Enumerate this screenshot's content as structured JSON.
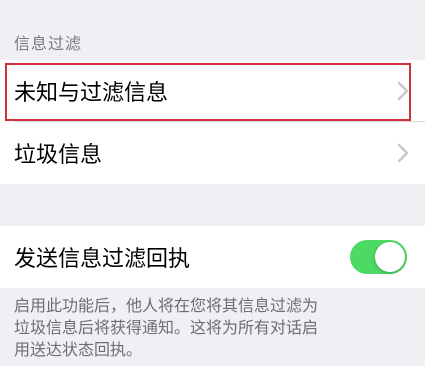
{
  "filter_section": {
    "header": "信息过滤",
    "items": [
      {
        "label": "未知与过滤信息",
        "icon": "chevron-right-icon",
        "highlighted": true
      },
      {
        "label": "垃圾信息",
        "icon": "chevron-right-icon"
      }
    ]
  },
  "receipt_section": {
    "toggle_label": "发送信息过滤回执",
    "toggle_on": true,
    "toggle_color": "#4cd964",
    "footer_lines": [
      "启用此功能后，他人将在您将其信息过滤为",
      "垃圾信息后将获得通知。这将为所有对话启",
      "用送达状态回执。"
    ]
  },
  "colors": {
    "highlight_border": "#d0313d",
    "background": "#efeff4"
  }
}
